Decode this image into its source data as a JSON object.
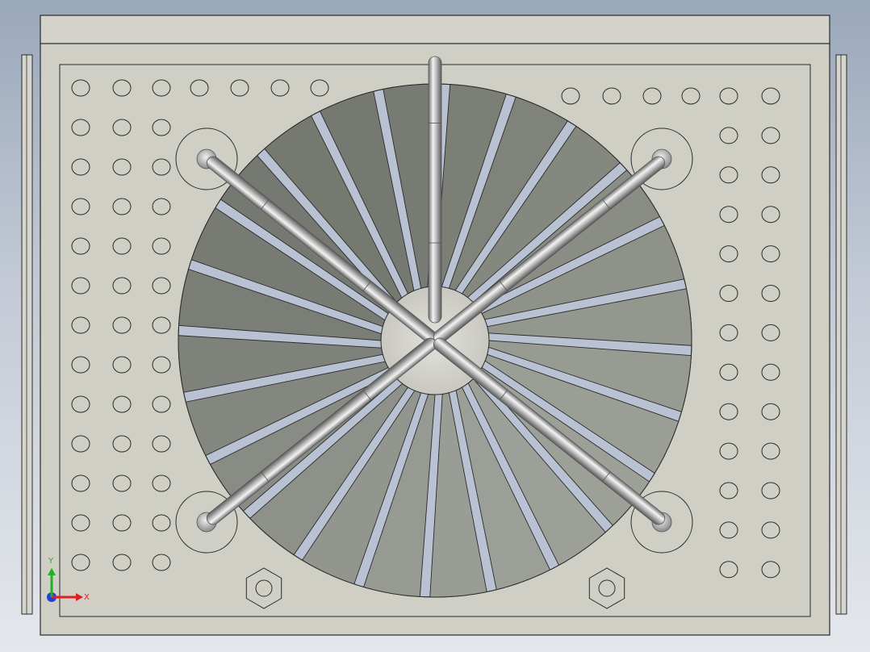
{
  "viewport": {
    "axes": {
      "x_label": "X",
      "y_label": "Y"
    }
  },
  "model": {
    "blade_count": 24,
    "spoke_count": 5,
    "left_hole_grid": {
      "columns": 3,
      "rows": 13,
      "top_row_count": 7
    },
    "right_hole_grid": {
      "columns": 2,
      "rows": 13,
      "top_row_count": 6
    },
    "mount_boss_count": 4,
    "hex_nut_count": 2
  },
  "colors": {
    "plate": "#cfcfc6",
    "plate_edge": "#2a2a2a",
    "blade_dark": "#5a5d54",
    "blade_light": "#a9aca4",
    "slot": "#b8c2d2",
    "spoke_light": "#f2f2f2",
    "spoke_dark": "#6e6e6e",
    "axis_x": "#e02020",
    "axis_y": "#20b020",
    "axis_z": "#2040e0"
  }
}
